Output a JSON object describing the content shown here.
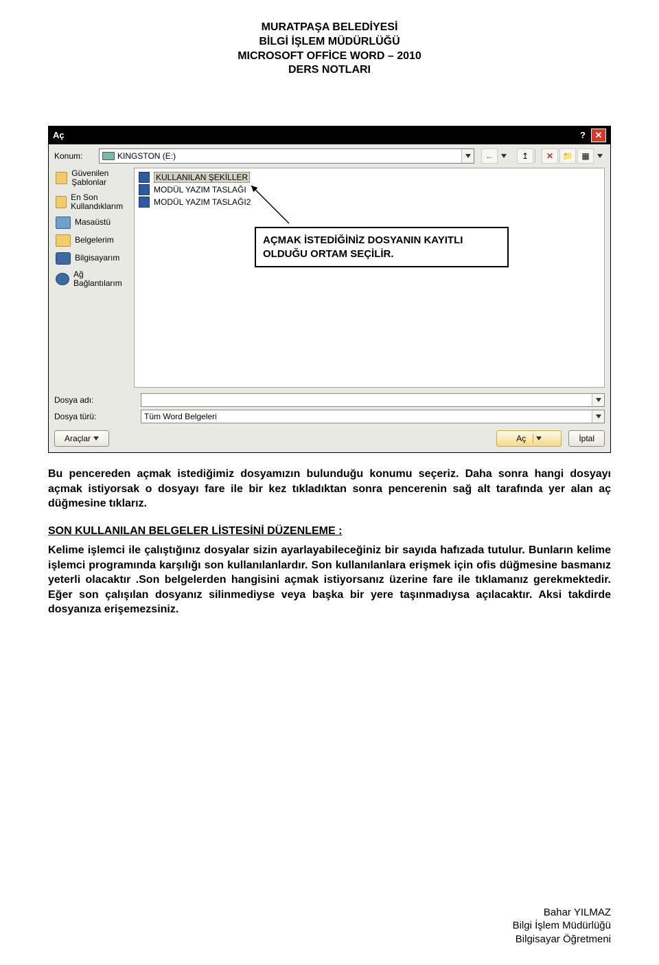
{
  "header": {
    "line1": "MURATPAŞA BELEDİYESİ",
    "line2": "BİLGİ İŞLEM MÜDÜRLÜĞÜ",
    "line3": "MICROSOFT OFFİCE WORD – 2010",
    "line4": "DERS NOTLARI"
  },
  "dialog": {
    "title": "Aç",
    "help_glyph": "?",
    "close_glyph": "✕",
    "konum_label": "Konum:",
    "konum_value": "KINGSTON (E:)",
    "toolbar": {
      "back": "←",
      "up": "↥",
      "delete": "✕",
      "newfolder": "📁",
      "views": "▦"
    },
    "sidebar": [
      {
        "label": "Güvenilen Şablonlar",
        "iconClass": "si-folder"
      },
      {
        "label": "En Son Kullandıklarım",
        "iconClass": "si-folder2"
      },
      {
        "label": "Masaüstü",
        "iconClass": "si-desktop"
      },
      {
        "label": "Belgelerim",
        "iconClass": "si-docs"
      },
      {
        "label": "Bilgisayarım",
        "iconClass": "si-pc"
      },
      {
        "label": "Ağ Bağlantılarım",
        "iconClass": "si-net"
      }
    ],
    "files": [
      {
        "name": "KULLANILAN ŞEKİLLER",
        "selected": true
      },
      {
        "name": "MODÜL YAZIM TASLAĞI",
        "selected": false
      },
      {
        "name": "MODÜL YAZIM TASLAĞI2",
        "selected": false
      }
    ],
    "callout": "AÇMAK İSTEDİĞİNİZ DOSYANIN KAYITLI OLDUĞU ORTAM SEÇİLİR.",
    "dosya_adi_label": "Dosya adı:",
    "dosya_adi_value": "",
    "dosya_turu_label": "Dosya türü:",
    "dosya_turu_value": "Tüm Word Belgeleri",
    "btn_tools": "Araçlar",
    "btn_open": "Aç",
    "btn_cancel": "İptal"
  },
  "body": {
    "para1": "Bu pencereden açmak istediğimiz dosyamızın bulunduğu konumu seçeriz. Daha sonra hangi dosyayı açmak istiyorsak o dosyayı fare ile bir kez tıkladıktan sonra pencerenin sağ alt tarafında yer alan aç düğmesine tıklarız.",
    "section_title": "SON KULLANILAN BELGELER LİSTESİNİ DÜZENLEME :",
    "para2": "Kelime işlemci ile çalıştığınız dosyalar sizin ayarlayabileceğiniz bir sayıda hafızada tutulur. Bunların kelime işlemci programında karşılığı son kullanılanlardır. Son kullanılanlara erişmek için ofis düğmesine basmanız yeterli olacaktır .Son belgelerden hangisini açmak istiyorsanız üzerine fare ile tıklamanız gerekmektedir. Eğer son çalışılan dosyanız silinmediyse veya başka bir yere taşınmadıysa açılacaktır. Aksi takdirde dosyanıza erişemezsiniz."
  },
  "footer": {
    "name": "Bahar YILMAZ",
    "dept": "Bilgi İşlem Müdürlüğü",
    "role": "Bilgisayar Öğretmeni"
  }
}
